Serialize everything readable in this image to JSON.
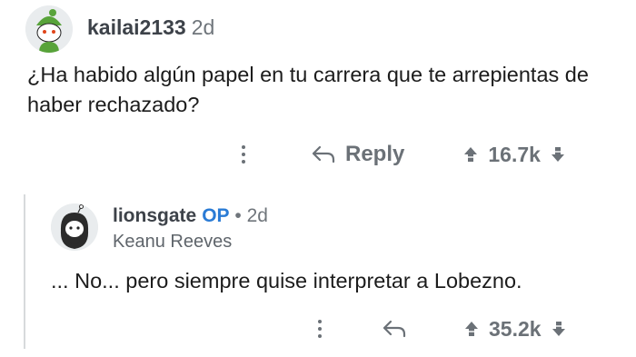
{
  "comment": {
    "username": "kailai2133",
    "age": "2d",
    "body": "¿Ha habido algún papel en tu carrera que te arrepientas de haber rechazado?",
    "reply_label": "Reply",
    "score": "16.7k"
  },
  "reply": {
    "username": "lionsgate",
    "op_badge": "OP",
    "separator": "•",
    "age": "2d",
    "flair": "Keanu Reeves",
    "body": "... No... pero siempre quise interpretar a Lobezno.",
    "score": "35.2k"
  },
  "colors": {
    "accent_op": "#2a7bd5",
    "meta_gray": "#6b7177",
    "thread_line": "#d7dadc",
    "text": "#1c1c1c"
  },
  "icons": [
    "snoo-avatar-icon",
    "bearded-avatar-icon",
    "more-options-icon",
    "reply-arrow-icon",
    "upvote-icon",
    "downvote-icon"
  ]
}
